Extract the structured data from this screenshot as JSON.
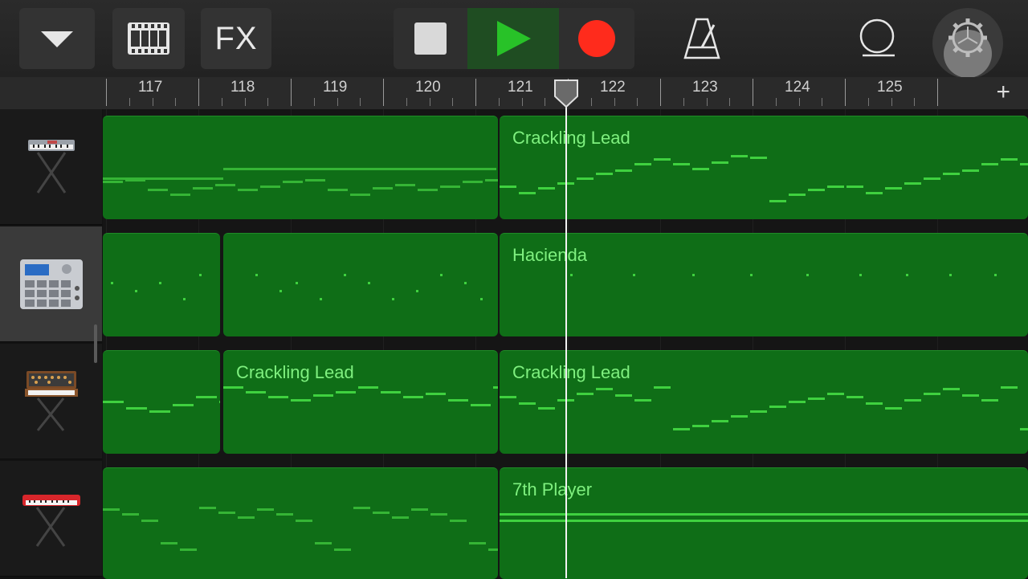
{
  "toolbar": {
    "tracks_menu_icon": "chevron-down-icon",
    "loop_browser_icon": "film-strip-icon",
    "fx_label": "FX",
    "stop_icon": "stop-icon",
    "play_icon": "play-icon",
    "record_icon": "record-icon",
    "metronome_icon": "metronome-icon",
    "loop_icon": "loop-icon",
    "settings_icon": "gear-icon",
    "colors": {
      "play_green": "#28c228",
      "record_red": "#ff2b1c",
      "stop_grey": "#d9d9d9"
    }
  },
  "ruler": {
    "bars": [
      "117",
      "118",
      "119",
      "120",
      "121",
      "122",
      "123",
      "124",
      "125"
    ],
    "plus_label": "+"
  },
  "tracks": [
    {
      "instrument_icon": "keyboard-synth-icon",
      "regions": [
        {
          "name": ""
        },
        {
          "name": "Crackling Lead"
        }
      ]
    },
    {
      "instrument_icon": "drum-machine-icon",
      "selected": true,
      "regions": [
        {
          "name": ""
        },
        {
          "name": ""
        },
        {
          "name": "Hacienda"
        }
      ]
    },
    {
      "instrument_icon": "analog-synth-icon",
      "regions": [
        {
          "name": ""
        },
        {
          "name": "Crackling Lead"
        },
        {
          "name": "Crackling Lead"
        }
      ]
    },
    {
      "instrument_icon": "red-keyboard-icon",
      "regions": [
        {
          "name": ""
        },
        {
          "name": "7th Player"
        }
      ]
    }
  ],
  "colors": {
    "region_green": "#0f6e17",
    "note_green": "#3fd13f",
    "region_label": "#7ff07f"
  }
}
